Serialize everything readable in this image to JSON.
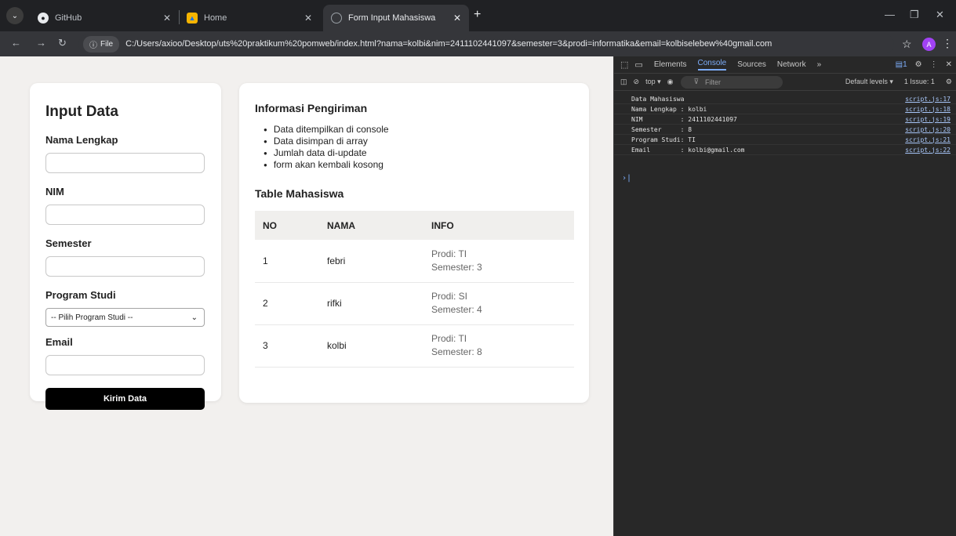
{
  "tabs": [
    {
      "title": "GitHub",
      "close": "✕"
    },
    {
      "title": "Home",
      "close": "✕"
    },
    {
      "title": "Form Input Mahasiswa",
      "close": "✕"
    }
  ],
  "toolbar": {
    "file_chip": "File",
    "url": "C:/Users/axioo/Desktop/uts%20praktikum%20pomweb/index.html?nama=kolbi&nim=2411102441097&semester=3&prodi=informatika&email=kolbiselebew%40gmail.com",
    "avatar_letter": "A"
  },
  "form": {
    "title": "Input Data",
    "label_nama": "Nama Lengkap",
    "label_nim": "NIM",
    "label_semester": "Semester",
    "label_prodi": "Program Studi",
    "prodi_selected": "-- Pilih Program Studi --",
    "label_email": "Email",
    "submit_label": "Kirim Data"
  },
  "info": {
    "title": "Informasi Pengiriman",
    "items": [
      "Data ditempilkan di console",
      "Data disimpan di array",
      "Jumlah data di-update",
      "form akan kembali kosong"
    ],
    "table_title": "Table Mahasiswa",
    "columns": [
      "NO",
      "NAMA",
      "INFO"
    ],
    "rows": [
      {
        "no": "1",
        "nama": "febri",
        "prodi": "Prodi: TI",
        "semester": "Semester: 3"
      },
      {
        "no": "2",
        "nama": "rifki",
        "prodi": "Prodi: SI",
        "semester": "Semester: 4"
      },
      {
        "no": "3",
        "nama": "kolbi",
        "prodi": "Prodi: TI",
        "semester": "Semester: 8"
      }
    ]
  },
  "devtools": {
    "tabs": [
      "Elements",
      "Console",
      "Sources",
      "Network"
    ],
    "more": "»",
    "badge": "1",
    "context": "top ▾",
    "filter_placeholder": "Filter",
    "levels": "Default levels ▾",
    "issues": "1 Issue: 1",
    "console": [
      {
        "text": "Data Mahasiswa",
        "src": "script.js:17"
      },
      {
        "text": "Nama Lengkap : kolbi",
        "src": "script.js:18"
      },
      {
        "text": "NIM          : 2411102441097",
        "src": "script.js:19"
      },
      {
        "text": "Semester     : 8",
        "src": "script.js:20"
      },
      {
        "text": "Program Studi: TI",
        "src": "script.js:21"
      },
      {
        "text": "Email        : kolbi@gmail.com",
        "src": "script.js:22"
      }
    ],
    "prompt": "›|"
  }
}
